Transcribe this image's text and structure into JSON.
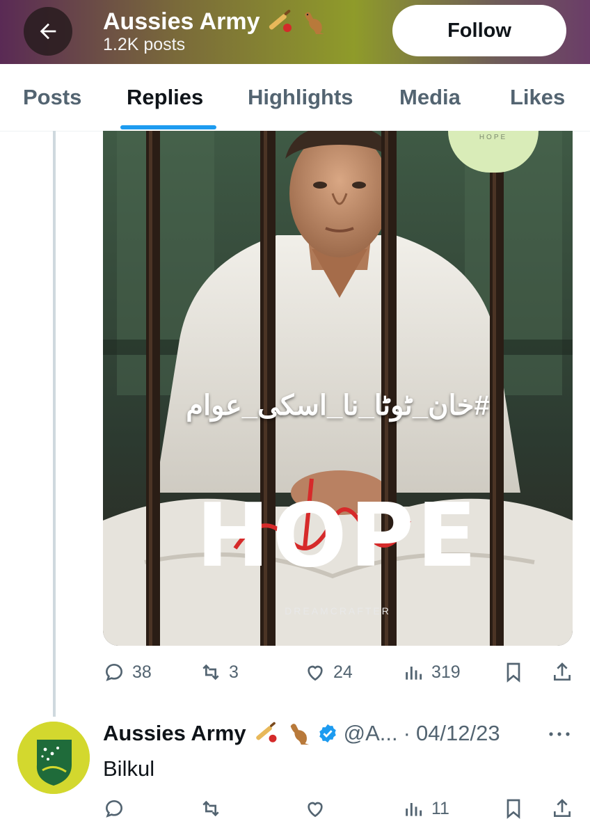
{
  "header": {
    "name": "Aussies Army",
    "posts_count": "1.2K posts",
    "follow_label": "Follow"
  },
  "tabs": [
    {
      "label": "Posts"
    },
    {
      "label": "Replies",
      "active": true
    },
    {
      "label": "Highlights"
    },
    {
      "label": "Media"
    },
    {
      "label": "Likes"
    }
  ],
  "media": {
    "hashtag": "#خان_ٹوٹا_نا_اسکی_عوام",
    "title": "HOPE",
    "brand": "DREAMCRAFTER",
    "badge": "HOPE"
  },
  "tweet_actions": {
    "replies": "38",
    "reposts": "3",
    "likes": "24",
    "views": "319"
  },
  "reply": {
    "name": "Aussies Army",
    "handle": "@A...",
    "separator": "·",
    "date": "04/12/23",
    "text": "Bilkul",
    "views": "11"
  },
  "colors": {
    "accent": "#1d9bf0",
    "verified": "#1d9bf0",
    "muted": "#536471"
  }
}
